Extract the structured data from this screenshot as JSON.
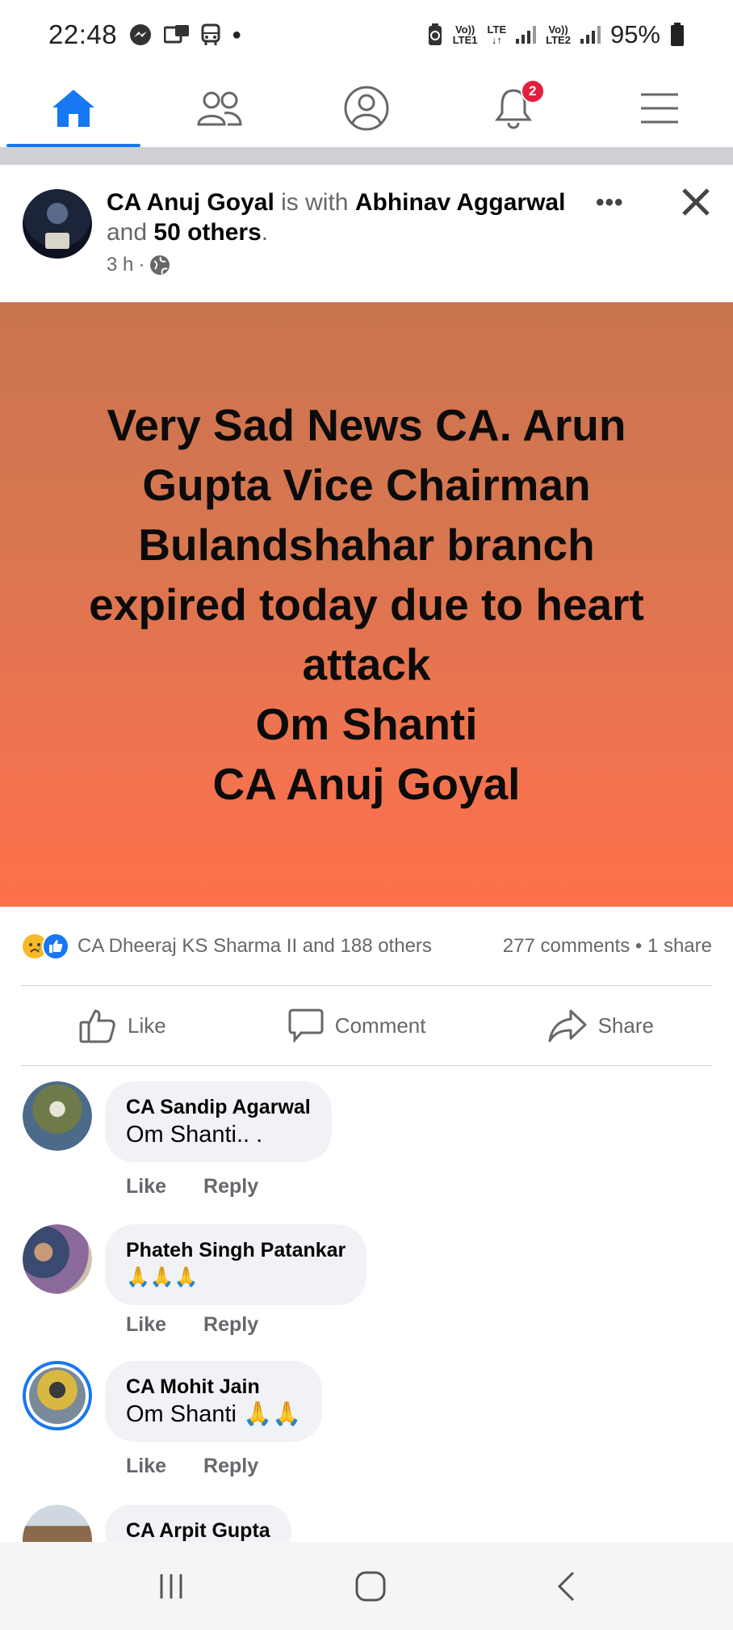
{
  "status_bar": {
    "time": "22:48",
    "battery": "95%",
    "sim1_top": "Vo))",
    "sim1_bottom": "LTE1",
    "lte_label": "LTE",
    "lte_arrows": "↓↑",
    "sim2_top": "Vo))",
    "sim2_bottom": "LTE2"
  },
  "topnav": {
    "tabs": [
      "home-icon",
      "friends-icon",
      "profile-icon",
      "notifications-icon",
      "menu-icon"
    ],
    "notification_count": "2"
  },
  "post": {
    "author": "CA Anuj Goyal",
    "with_text": " is with ",
    "tagged": "Abhinav Aggarwal",
    "and_text": " and ",
    "others": "50 others",
    "period": ".",
    "time": "3 h",
    "dot": "·",
    "image_lines": [
      "Very Sad News CA. Arun",
      "Gupta Vice Chairman",
      "Bulandshahar branch",
      "expired today due to heart",
      "attack",
      "Om Shanti",
      "CA Anuj Goyal"
    ],
    "reactions_text": "CA Dheeraj KS Sharma II and 188 others",
    "comments_share": "277 comments • 1 share"
  },
  "actions": {
    "like": "Like",
    "comment": "Comment",
    "share": "Share"
  },
  "comments": [
    {
      "name": "CA Sandip Agarwal",
      "text": "Om Shanti.. .",
      "like": "Like",
      "reply": "Reply"
    },
    {
      "name": "Phateh Singh Patankar",
      "text": "🙏🙏🙏",
      "like": "Like",
      "reply": "Reply"
    },
    {
      "name": "CA Mohit Jain",
      "text": "Om Shanti 🙏🙏",
      "like": "Like",
      "reply": "Reply"
    },
    {
      "name": "CA Arpit Gupta",
      "text": ""
    }
  ],
  "colors": {
    "accent": "#1877f2",
    "badge": "#e41e3f",
    "image_top": "#c9744f",
    "image_bottom": "#fe714a"
  }
}
